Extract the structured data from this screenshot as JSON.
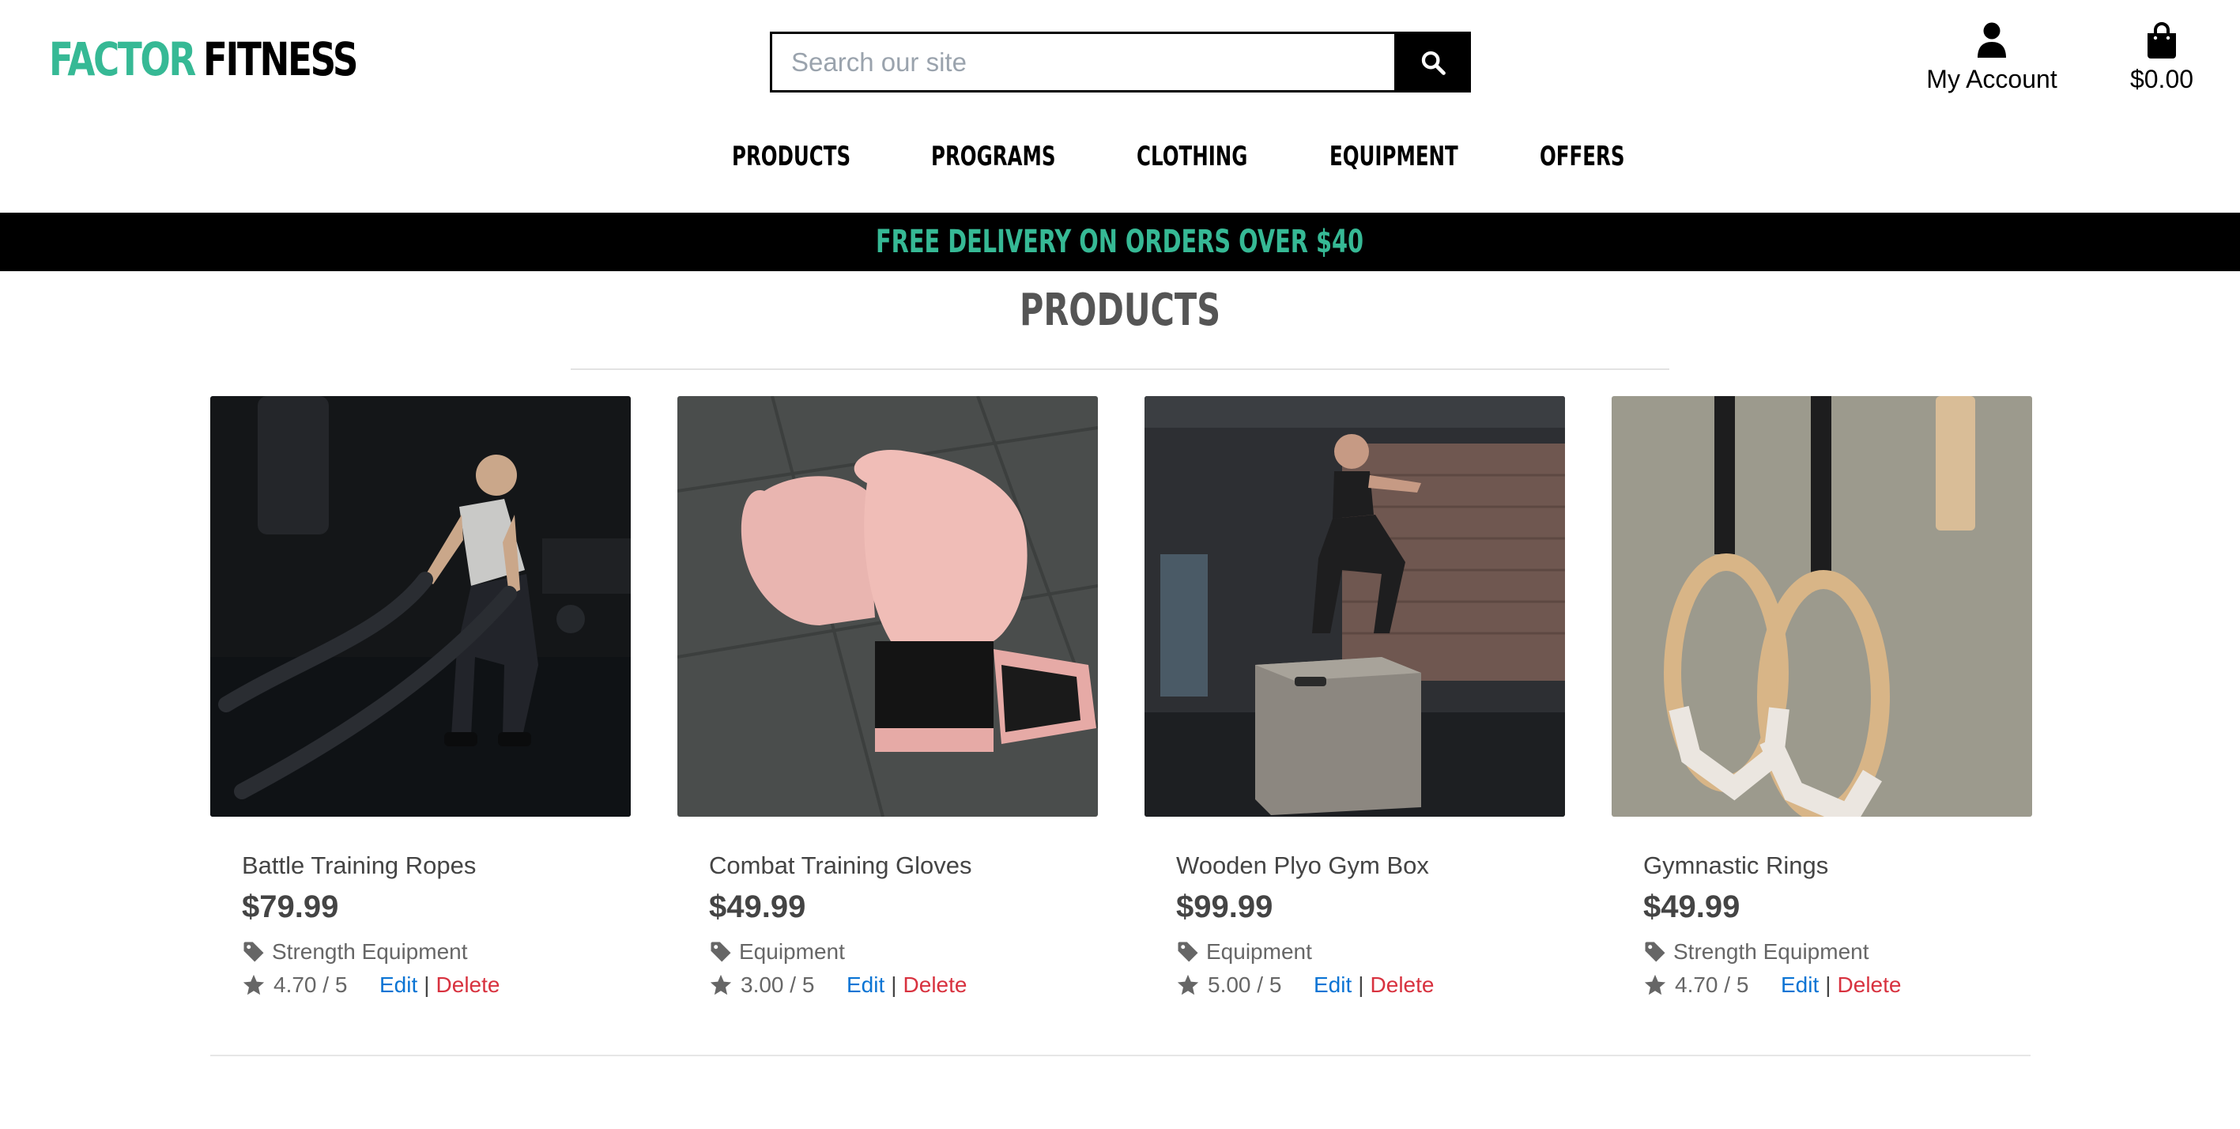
{
  "brand": {
    "logo_part1": "FACTOR",
    "logo_part2": "FITNESS",
    "accent_color": "#36b995"
  },
  "search": {
    "placeholder": "Search our site",
    "button_icon": "search-icon"
  },
  "account": {
    "label": "My Account",
    "icon": "user-icon"
  },
  "bag": {
    "total": "$0.00",
    "icon": "shopping-bag-icon"
  },
  "nav": {
    "items": [
      {
        "label": "Products"
      },
      {
        "label": "Programs"
      },
      {
        "label": "Clothing"
      },
      {
        "label": "Equipment"
      },
      {
        "label": "Offers"
      }
    ]
  },
  "banner": {
    "text": "FREE DELIVERY ON ORDERS OVER $40"
  },
  "page": {
    "title": "PRODUCTS"
  },
  "products": [
    {
      "name": "Battle Training Ropes",
      "price": "$79.99",
      "category": "Strength Equipment",
      "rating": "4.70 / 5",
      "image": "man-with-battle-ropes",
      "edit_label": "Edit",
      "separator": "|",
      "delete_label": "Delete"
    },
    {
      "name": "Combat Training Gloves",
      "price": "$49.99",
      "category": "Equipment",
      "rating": "3.00 / 5",
      "image": "pink-boxing-gloves",
      "edit_label": "Edit",
      "separator": "|",
      "delete_label": "Delete"
    },
    {
      "name": "Wooden Plyo Gym Box",
      "price": "$99.99",
      "category": "Equipment",
      "rating": "5.00 / 5",
      "image": "woman-box-jump",
      "edit_label": "Edit",
      "separator": "|",
      "delete_label": "Delete"
    },
    {
      "name": "Gymnastic Rings",
      "price": "$49.99",
      "category": "Strength Equipment",
      "rating": "4.70 / 5",
      "image": "wooden-gymnastic-rings",
      "edit_label": "Edit",
      "separator": "|",
      "delete_label": "Delete"
    }
  ],
  "colors": {
    "edit_link": "#0a74d4",
    "delete_link": "#d8323f",
    "banner_bg": "#000000"
  }
}
